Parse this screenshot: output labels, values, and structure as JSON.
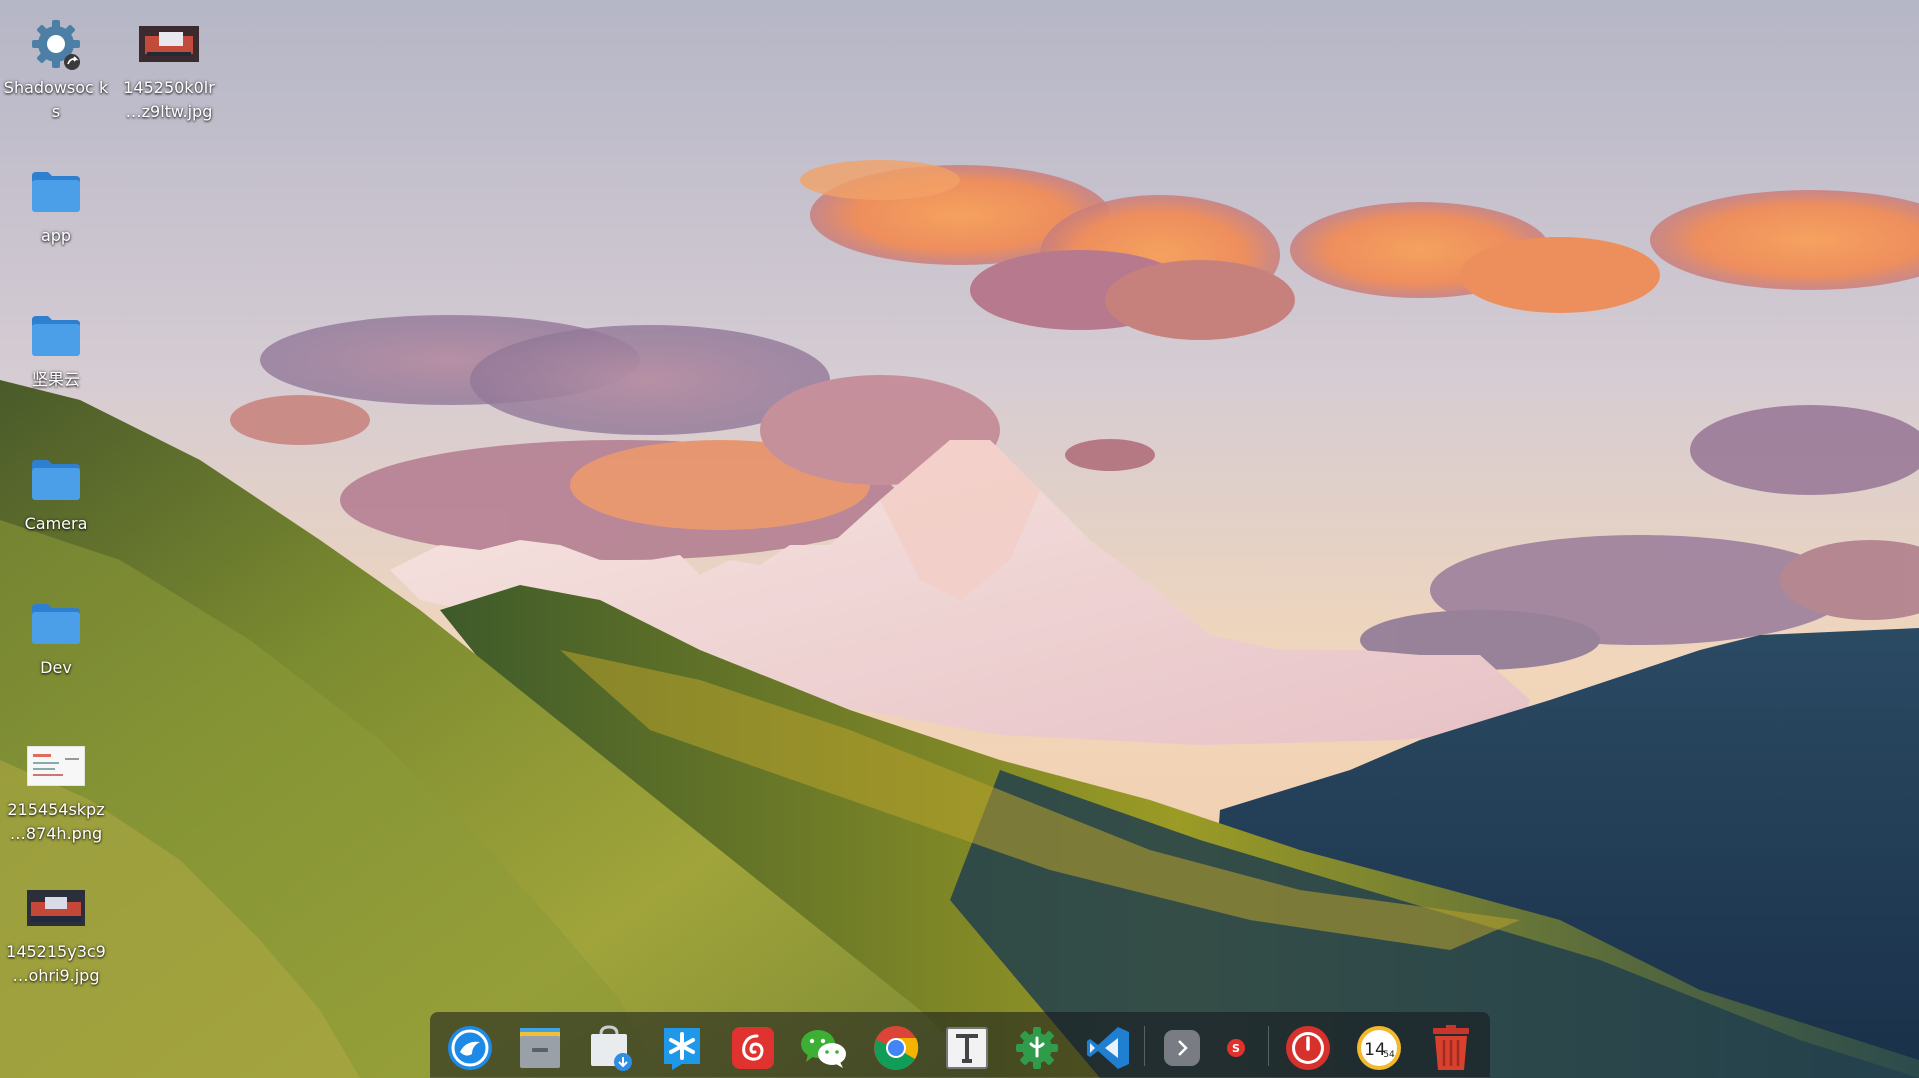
{
  "desktop": {
    "icons": [
      {
        "label": "Shadowsoc ks",
        "icon": "gear-shortcut-icon"
      },
      {
        "label": "145250k0lr …z9ltw.jpg",
        "icon": "image-thumbnail-icon"
      },
      {
        "label": "app",
        "icon": "folder-icon"
      },
      {
        "label": "坚果云",
        "icon": "folder-icon"
      },
      {
        "label": "Camera",
        "icon": "folder-icon"
      },
      {
        "label": "Dev",
        "icon": "folder-icon"
      },
      {
        "label": "215454skpz …874h.png",
        "icon": "image-thumbnail-icon"
      },
      {
        "label": "145215y3c9 …ohri9.jpg",
        "icon": "image-thumbnail-icon"
      }
    ]
  },
  "dock": {
    "apps": [
      {
        "icon": "deepin-launcher-icon"
      },
      {
        "icon": "file-manager-icon"
      },
      {
        "icon": "app-store-icon"
      },
      {
        "icon": "star-app-icon"
      },
      {
        "icon": "netease-music-icon"
      },
      {
        "icon": "wechat-icon"
      },
      {
        "icon": "chrome-icon"
      },
      {
        "icon": "typora-icon"
      },
      {
        "icon": "green-gear-app-icon"
      },
      {
        "icon": "vscode-icon"
      },
      {
        "icon": "tray-expand-icon"
      },
      {
        "icon": "shadowsocks-tray-icon"
      },
      {
        "icon": "power-icon"
      },
      {
        "icon": "clock-icon"
      },
      {
        "icon": "trash-icon"
      }
    ],
    "clock": {
      "hour": "14",
      "minute": "54"
    }
  },
  "colors": {
    "sky_top": "#b7b9c9",
    "sky_horizon": "#f0d2b4",
    "cloud_orange": "#f39253",
    "cloud_purple": "#9a7b9c",
    "mountain_dark": "#1f3d57",
    "hill_green": "#6e7f2a",
    "snow": "#f4ddd8",
    "folder_blue": "#4b9ee8"
  }
}
